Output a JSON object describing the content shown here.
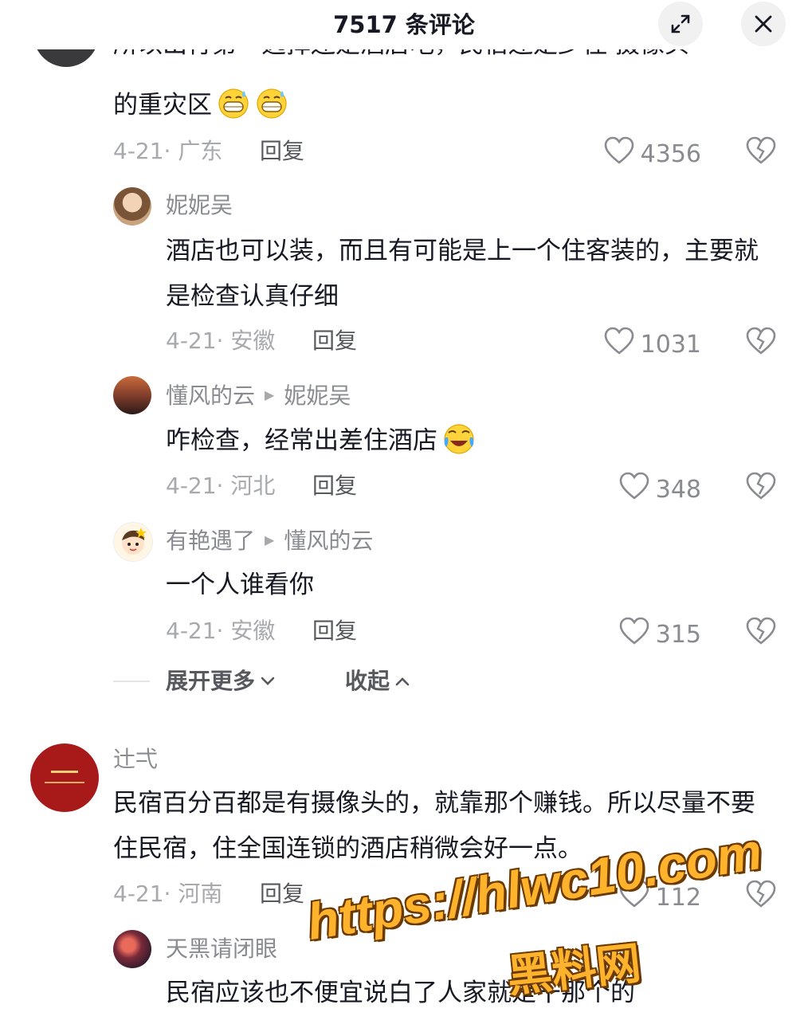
{
  "header": {
    "title": "7517 条评论",
    "expand_icon": "expand-icon",
    "close_icon": "close-icon"
  },
  "comments": [
    {
      "id": "c1",
      "text_line1": "所以出行第一选择还是酒店吧，民宿还是少住 摄像头",
      "text_line2": "的重灾区",
      "emojis": [
        "sweat-grin-emoji",
        "sweat-grin-emoji"
      ],
      "date_loc": "4-21· 广东",
      "reply": "回复",
      "likes": "4356"
    },
    {
      "id": "r1",
      "name": "妮妮吴",
      "text": "酒店也可以装，而且有可能是上一个住客装的，主要就是检查认真仔细",
      "date_loc": "4-21· 安徽",
      "reply": "回复",
      "likes": "1031"
    },
    {
      "id": "r2",
      "name": "懂风的云",
      "reply_to": "妮妮吴",
      "text": "咋检查，经常出差住酒店",
      "emoji": "crying-laughing-emoji",
      "date_loc": "4-21· 河北",
      "reply": "回复",
      "likes": "348"
    },
    {
      "id": "r3",
      "name": "有艳遇了",
      "reply_to": "懂风的云",
      "text": "一个人谁看你",
      "date_loc": "4-21· 安徽",
      "reply": "回复",
      "likes": "315"
    },
    {
      "id": "c2",
      "name": "辻弌",
      "text": "民宿百分百都是有摄像头的，就靠那个赚钱。所以尽量不要住民宿，住全国连锁的酒店稍微会好一点。",
      "date_loc": "4-21· 河南",
      "reply": "回复",
      "likes": "112"
    },
    {
      "id": "r4",
      "name": "天黑请闭眼",
      "text": "民宿应该也不便宜说白了人家就是干那个的"
    }
  ],
  "thread": {
    "expand_more": "展开更多",
    "collapse": "收起"
  },
  "watermark": {
    "url": "https://hlwc10.com",
    "cn": "黑料网"
  },
  "colors": {
    "text": "#161823",
    "meta": "#a8a9ad",
    "name": "#8a8b91",
    "watermark": "#ffb22c"
  }
}
